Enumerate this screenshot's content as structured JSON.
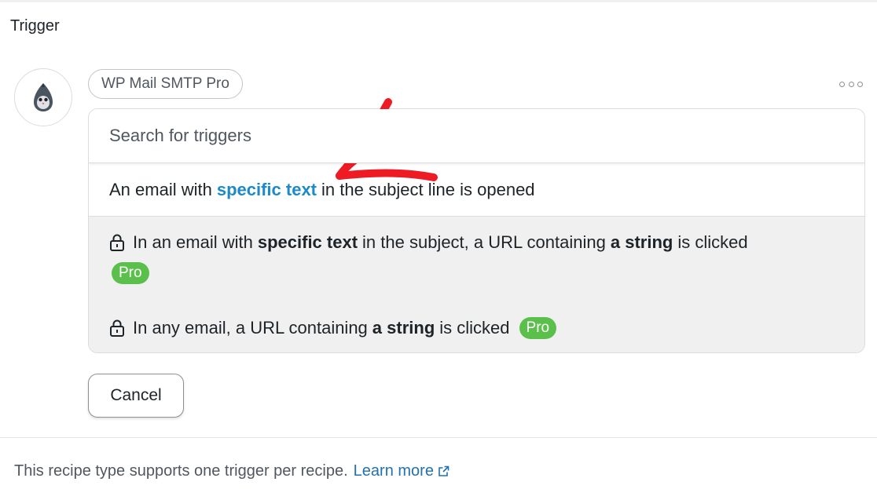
{
  "section": {
    "title": "Trigger"
  },
  "integration": {
    "name": "WP Mail SMTP Pro",
    "avatar_icon": "pigeon-icon"
  },
  "more_menu": {
    "icon": "more-horizontal-icon"
  },
  "search": {
    "placeholder": "Search for triggers"
  },
  "options": {
    "free": {
      "before": "An email with",
      "token": "specific text",
      "after": "in the subject line is opened"
    },
    "locked": [
      {
        "part1": "In an email with",
        "token1": "specific text",
        "part2": "in the subject, a URL containing",
        "token2": "a string",
        "part3": "is clicked",
        "badge": "Pro"
      },
      {
        "part1": "In any email, a URL containing",
        "token1": "a string",
        "part2": "is clicked",
        "badge": "Pro"
      }
    ]
  },
  "actions": {
    "cancel_label": "Cancel"
  },
  "footer": {
    "note": "This recipe type supports one trigger per recipe.",
    "link_label": "Learn more"
  },
  "colors": {
    "link_token": "#1b8ac9",
    "pro_badge": "#5bc04b",
    "annotation_arrow": "#ee1b24",
    "locked_background": "#f0f0f1"
  }
}
